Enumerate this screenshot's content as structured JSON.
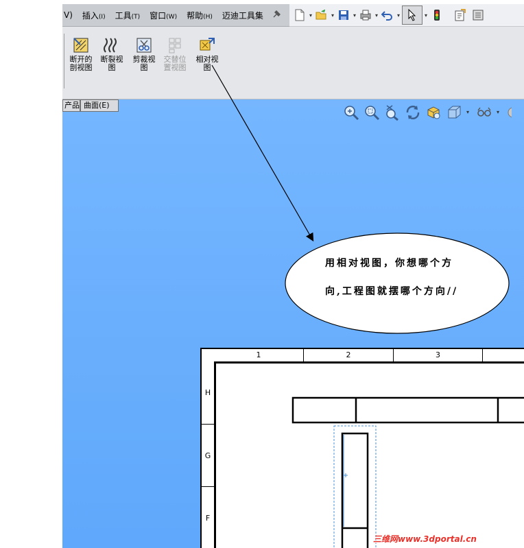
{
  "menubar": {
    "partial_view_label": "V)",
    "items": [
      {
        "label": "插入",
        "key": "(I)"
      },
      {
        "label": "工具",
        "key": "(T)"
      },
      {
        "label": "窗口",
        "key": "(W)"
      },
      {
        "label": "帮助",
        "key": "(H)"
      },
      {
        "label": "迈迪工具集",
        "key": ""
      }
    ]
  },
  "command_manager": {
    "buttons": [
      {
        "line1": "断开的",
        "line2": "剖视图",
        "enabled": true
      },
      {
        "line1": "断裂视",
        "line2": "图",
        "enabled": true
      },
      {
        "line1": "剪裁视",
        "line2": "图",
        "enabled": true
      },
      {
        "line1": "交替位",
        "line2": "置视图",
        "enabled": false
      },
      {
        "line1": "相对视",
        "line2": "图",
        "enabled": true
      }
    ]
  },
  "tabs": {
    "partial_tab": "产品",
    "surface_tab": "曲面(E)"
  },
  "callout": {
    "line1": "用相对视图，你想哪个方",
    "line2": "向,工程图就摆哪个方向//"
  },
  "sheet": {
    "column_zones": [
      "1",
      "2",
      "3"
    ],
    "row_zones": [
      "H",
      "G",
      "F"
    ]
  },
  "watermark": "三维网www.3dportal.cn",
  "colors": {
    "viewport_top": "#75b6ff",
    "viewport_bottom": "#5fa8fb",
    "menubar": "#c9ccd1",
    "toolbar": "#e4e6e9",
    "watermark": "#e8312a"
  }
}
